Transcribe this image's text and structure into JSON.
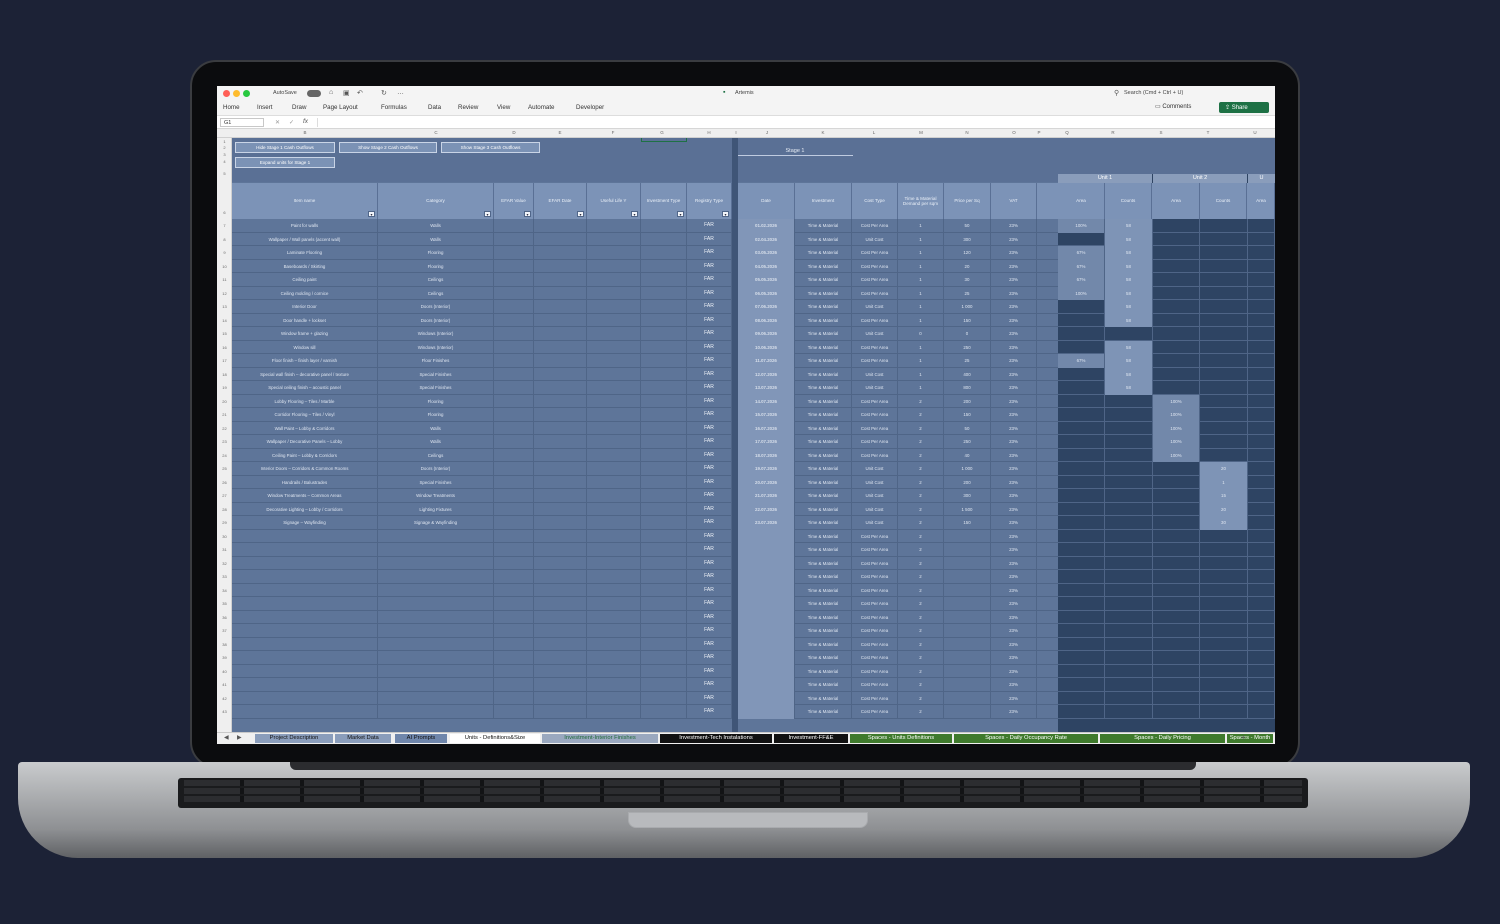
{
  "window": {
    "title": "Artemis",
    "autosave_label": "AutoSave",
    "search_placeholder": "Search (Cmd + Ctrl + U)"
  },
  "ribbon": {
    "tabs": [
      "Home",
      "Insert",
      "Draw",
      "Page Layout",
      "Formulas",
      "Data",
      "Review",
      "View",
      "Automate",
      "Developer"
    ],
    "comments_label": "Comments",
    "share_label": "Share"
  },
  "formula_bar": {
    "cell_ref": "G1",
    "fx_label": "fx"
  },
  "columns": [
    "B",
    "C",
    "D",
    "E",
    "F",
    "G",
    "H",
    "I",
    "J",
    "K",
    "L",
    "M",
    "N",
    "O",
    "P",
    "Q",
    "R",
    "S",
    "T",
    "U"
  ],
  "row_numbers": [
    "1",
    "2",
    "3",
    "4",
    "5",
    "6",
    "7",
    "8",
    "9",
    "10",
    "11",
    "12",
    "13",
    "14",
    "15",
    "16",
    "17",
    "18",
    "19",
    "20",
    "21",
    "22",
    "23",
    "24",
    "25",
    "26",
    "27",
    "28",
    "29",
    "30",
    "31",
    "32",
    "33",
    "34",
    "35",
    "36",
    "37",
    "38",
    "39",
    "40",
    "41",
    "42",
    "43"
  ],
  "buttons": {
    "hide_stage1": "Hide Stage 1 Cash Outflows",
    "show_stage2": "Show Stage 2 Cash Outflows",
    "show_stage3": "Show Stage 3 Cash Outflows",
    "expand_units": "Expand units for Stage 1"
  },
  "stage_label": "Stage 1",
  "units": [
    "Unit 1",
    "Unit 2",
    "U"
  ],
  "headers": {
    "item_name": "Item name",
    "category": "Category",
    "efar_value": "EFAR Value",
    "efar_date": "EFAR Date",
    "useful_life": "Useful Life Y",
    "investment_type": "Investment Type",
    "registry_type": "Registry Type",
    "date": "Date",
    "investment": "Investment",
    "cost_type": "Cost Type",
    "demand": "Time & Material Demand per sqm",
    "price": "Price per Sq",
    "vat": "VAT",
    "u1_area": "Area",
    "u1_counts": "Counts",
    "u2_area": "Area",
    "u2_counts": "Counts",
    "u3_area": "Area"
  },
  "rows": [
    {
      "item": "Paint for walls",
      "cat": "Walls",
      "reg": "FAR",
      "date": "01.02.2026",
      "inv": "Time & Material",
      "cost": "Cost Per Area",
      "dem": "1",
      "price": "50",
      "vat": "23%",
      "u1a": "100%",
      "u1c": "58",
      "u2a": "",
      "u2c": ""
    },
    {
      "item": "Wallpaper / Wall panels (accent wall)",
      "cat": "Walls",
      "reg": "FAR",
      "date": "02.04.2026",
      "inv": "Time & Material",
      "cost": "Unit Cost",
      "dem": "1",
      "price": "300",
      "vat": "23%",
      "u1a": "",
      "u1c": "58",
      "u2a": "",
      "u2c": ""
    },
    {
      "item": "Laminate Flooring",
      "cat": "Flooring",
      "reg": "FAR",
      "date": "03.05.2026",
      "inv": "Time & Material",
      "cost": "Cost Per Area",
      "dem": "1",
      "price": "120",
      "vat": "23%",
      "u1a": "67%",
      "u1c": "58",
      "u2a": "",
      "u2c": ""
    },
    {
      "item": "Baseboards / Skirting",
      "cat": "Flooring",
      "reg": "FAR",
      "date": "04.05.2026",
      "inv": "Time & Material",
      "cost": "Cost Per Area",
      "dem": "1",
      "price": "20",
      "vat": "23%",
      "u1a": "67%",
      "u1c": "58",
      "u2a": "",
      "u2c": ""
    },
    {
      "item": "Ceiling paint",
      "cat": "Ceilings",
      "reg": "FAR",
      "date": "05.05.2026",
      "inv": "Time & Material",
      "cost": "Cost Per Area",
      "dem": "1",
      "price": "30",
      "vat": "23%",
      "u1a": "67%",
      "u1c": "58",
      "u2a": "",
      "u2c": ""
    },
    {
      "item": "Ceiling molding / cornice",
      "cat": "Ceilings",
      "reg": "FAR",
      "date": "06.05.2026",
      "inv": "Time & Material",
      "cost": "Cost Per Area",
      "dem": "1",
      "price": "25",
      "vat": "23%",
      "u1a": "100%",
      "u1c": "58",
      "u2a": "",
      "u2c": ""
    },
    {
      "item": "Interior Door",
      "cat": "Doors (Interior)",
      "reg": "FAR",
      "date": "07.06.2026",
      "inv": "Time & Material",
      "cost": "Unit Cost",
      "dem": "1",
      "price": "1 000",
      "vat": "23%",
      "u1a": "",
      "u1c": "58",
      "u2a": "",
      "u2c": ""
    },
    {
      "item": "Door handle + lockset",
      "cat": "Doors (Interior)",
      "reg": "FAR",
      "date": "08.06.2026",
      "inv": "Time & Material",
      "cost": "Cost Per Area",
      "dem": "1",
      "price": "150",
      "vat": "23%",
      "u1a": "",
      "u1c": "58",
      "u2a": "",
      "u2c": ""
    },
    {
      "item": "Window frame + glazing",
      "cat": "Windows (Interior)",
      "reg": "FAR",
      "date": "09.06.2026",
      "inv": "Time & Material",
      "cost": "Unit Cost",
      "dem": "0",
      "price": "0",
      "vat": "23%",
      "u1a": "",
      "u1c": "",
      "u2a": "",
      "u2c": ""
    },
    {
      "item": "Window sill",
      "cat": "Windows (Interior)",
      "reg": "FAR",
      "date": "10.06.2026",
      "inv": "Time & Material",
      "cost": "Cost Per Area",
      "dem": "1",
      "price": "250",
      "vat": "23%",
      "u1a": "",
      "u1c": "58",
      "u2a": "",
      "u2c": ""
    },
    {
      "item": "Floor finish – finish layer / varnish",
      "cat": "Floor Finishes",
      "reg": "FAR",
      "date": "11.07.2026",
      "inv": "Time & Material",
      "cost": "Cost Per Area",
      "dem": "1",
      "price": "25",
      "vat": "23%",
      "u1a": "67%",
      "u1c": "58",
      "u2a": "",
      "u2c": ""
    },
    {
      "item": "Special wall finish – decorative panel / texture",
      "cat": "Special Finishes",
      "reg": "FAR",
      "date": "12.07.2026",
      "inv": "Time & Material",
      "cost": "Unit Cost",
      "dem": "1",
      "price": "400",
      "vat": "23%",
      "u1a": "",
      "u1c": "58",
      "u2a": "",
      "u2c": ""
    },
    {
      "item": "Special ceiling finish – acoustic panel",
      "cat": "Special Finishes",
      "reg": "FAR",
      "date": "13.07.2026",
      "inv": "Time & Material",
      "cost": "Unit Cost",
      "dem": "1",
      "price": "800",
      "vat": "23%",
      "u1a": "",
      "u1c": "58",
      "u2a": "",
      "u2c": ""
    },
    {
      "item": "Lobby Flooring – Tiles / Marble",
      "cat": "Flooring",
      "reg": "FAR",
      "date": "14.07.2026",
      "inv": "Time & Material",
      "cost": "Cost Per Area",
      "dem": "2",
      "price": "200",
      "vat": "23%",
      "u1a": "",
      "u1c": "",
      "u2a": "100%",
      "u2c": ""
    },
    {
      "item": "Corridor Flooring – Tiles / Vinyl",
      "cat": "Flooring",
      "reg": "FAR",
      "date": "15.07.2026",
      "inv": "Time & Material",
      "cost": "Cost Per Area",
      "dem": "2",
      "price": "150",
      "vat": "23%",
      "u1a": "",
      "u1c": "",
      "u2a": "100%",
      "u2c": ""
    },
    {
      "item": "Wall Paint – Lobby & Corridors",
      "cat": "Walls",
      "reg": "FAR",
      "date": "16.07.2026",
      "inv": "Time & Material",
      "cost": "Cost Per Area",
      "dem": "2",
      "price": "50",
      "vat": "23%",
      "u1a": "",
      "u1c": "",
      "u2a": "100%",
      "u2c": ""
    },
    {
      "item": "Wallpaper / Decorative Panels – Lobby",
      "cat": "Walls",
      "reg": "FAR",
      "date": "17.07.2026",
      "inv": "Time & Material",
      "cost": "Cost Per Area",
      "dem": "2",
      "price": "250",
      "vat": "23%",
      "u1a": "",
      "u1c": "",
      "u2a": "100%",
      "u2c": ""
    },
    {
      "item": "Ceiling Paint – Lobby & Corridors",
      "cat": "Ceilings",
      "reg": "FAR",
      "date": "18.07.2026",
      "inv": "Time & Material",
      "cost": "Cost Per Area",
      "dem": "2",
      "price": "40",
      "vat": "23%",
      "u1a": "",
      "u1c": "",
      "u2a": "100%",
      "u2c": ""
    },
    {
      "item": "Interior Doors – Corridors & Common Rooms",
      "cat": "Doors (Interior)",
      "reg": "FAR",
      "date": "19.07.2026",
      "inv": "Time & Material",
      "cost": "Unit Cost",
      "dem": "2",
      "price": "1 000",
      "vat": "23%",
      "u1a": "",
      "u1c": "",
      "u2a": "",
      "u2c": "20"
    },
    {
      "item": "Handrails / Balustrades",
      "cat": "Special Finishes",
      "reg": "FAR",
      "date": "20.07.2026",
      "inv": "Time & Material",
      "cost": "Unit Cost",
      "dem": "2",
      "price": "200",
      "vat": "23%",
      "u1a": "",
      "u1c": "",
      "u2a": "",
      "u2c": "1"
    },
    {
      "item": "Window Treatments – Common Areas",
      "cat": "Window Treatments",
      "reg": "FAR",
      "date": "21.07.2026",
      "inv": "Time & Material",
      "cost": "Unit Cost",
      "dem": "2",
      "price": "300",
      "vat": "23%",
      "u1a": "",
      "u1c": "",
      "u2a": "",
      "u2c": "15"
    },
    {
      "item": "Decorative Lighting – Lobby / Corridors",
      "cat": "Lighting Fixtures",
      "reg": "FAR",
      "date": "22.07.2026",
      "inv": "Time & Material",
      "cost": "Unit Cost",
      "dem": "2",
      "price": "1 500",
      "vat": "23%",
      "u1a": "",
      "u1c": "",
      "u2a": "",
      "u2c": "20"
    },
    {
      "item": "Signage – Wayfinding",
      "cat": "Signage & Wayfinding",
      "reg": "FAR",
      "date": "23.07.2026",
      "inv": "Time & Material",
      "cost": "Unit Cost",
      "dem": "2",
      "price": "150",
      "vat": "23%",
      "u1a": "",
      "u1c": "",
      "u2a": "",
      "u2c": "30"
    },
    {
      "item": "",
      "cat": "",
      "reg": "FAR",
      "date": "",
      "inv": "Time & Material",
      "cost": "Cost Per Area",
      "dem": "2",
      "price": "",
      "vat": "23%",
      "u1a": "",
      "u1c": "",
      "u2a": "",
      "u2c": ""
    },
    {
      "item": "",
      "cat": "",
      "reg": "FAR",
      "date": "",
      "inv": "Time & Material",
      "cost": "Cost Per Area",
      "dem": "2",
      "price": "",
      "vat": "23%",
      "u1a": "",
      "u1c": "",
      "u2a": "",
      "u2c": ""
    },
    {
      "item": "",
      "cat": "",
      "reg": "FAR",
      "date": "",
      "inv": "Time & Material",
      "cost": "Cost Per Area",
      "dem": "2",
      "price": "",
      "vat": "23%",
      "u1a": "",
      "u1c": "",
      "u2a": "",
      "u2c": ""
    },
    {
      "item": "",
      "cat": "",
      "reg": "FAR",
      "date": "",
      "inv": "Time & Material",
      "cost": "Cost Per Area",
      "dem": "2",
      "price": "",
      "vat": "23%",
      "u1a": "",
      "u1c": "",
      "u2a": "",
      "u2c": ""
    },
    {
      "item": "",
      "cat": "",
      "reg": "FAR",
      "date": "",
      "inv": "Time & Material",
      "cost": "Cost Per Area",
      "dem": "2",
      "price": "",
      "vat": "23%",
      "u1a": "",
      "u1c": "",
      "u2a": "",
      "u2c": ""
    },
    {
      "item": "",
      "cat": "",
      "reg": "FAR",
      "date": "",
      "inv": "Time & Material",
      "cost": "Cost Per Area",
      "dem": "2",
      "price": "",
      "vat": "23%",
      "u1a": "",
      "u1c": "",
      "u2a": "",
      "u2c": ""
    },
    {
      "item": "",
      "cat": "",
      "reg": "FAR",
      "date": "",
      "inv": "Time & Material",
      "cost": "Cost Per Area",
      "dem": "2",
      "price": "",
      "vat": "23%",
      "u1a": "",
      "u1c": "",
      "u2a": "",
      "u2c": ""
    },
    {
      "item": "",
      "cat": "",
      "reg": "FAR",
      "date": "",
      "inv": "Time & Material",
      "cost": "Cost Per Area",
      "dem": "2",
      "price": "",
      "vat": "23%",
      "u1a": "",
      "u1c": "",
      "u2a": "",
      "u2c": ""
    },
    {
      "item": "",
      "cat": "",
      "reg": "FAR",
      "date": "",
      "inv": "Time & Material",
      "cost": "Cost Per Area",
      "dem": "2",
      "price": "",
      "vat": "23%",
      "u1a": "",
      "u1c": "",
      "u2a": "",
      "u2c": ""
    },
    {
      "item": "",
      "cat": "",
      "reg": "FAR",
      "date": "",
      "inv": "Time & Material",
      "cost": "Cost Per Area",
      "dem": "2",
      "price": "",
      "vat": "23%",
      "u1a": "",
      "u1c": "",
      "u2a": "",
      "u2c": ""
    },
    {
      "item": "",
      "cat": "",
      "reg": "FAR",
      "date": "",
      "inv": "Time & Material",
      "cost": "Cost Per Area",
      "dem": "2",
      "price": "",
      "vat": "23%",
      "u1a": "",
      "u1c": "",
      "u2a": "",
      "u2c": ""
    },
    {
      "item": "",
      "cat": "",
      "reg": "FAR",
      "date": "",
      "inv": "Time & Material",
      "cost": "Cost Per Area",
      "dem": "2",
      "price": "",
      "vat": "23%",
      "u1a": "",
      "u1c": "",
      "u2a": "",
      "u2c": ""
    },
    {
      "item": "",
      "cat": "",
      "reg": "FAR",
      "date": "",
      "inv": "Time & Material",
      "cost": "Cost Per Area",
      "dem": "2",
      "price": "",
      "vat": "23%",
      "u1a": "",
      "u1c": "",
      "u2a": "",
      "u2c": ""
    },
    {
      "item": "",
      "cat": "",
      "reg": "FAR",
      "date": "",
      "inv": "Time & Material",
      "cost": "Cost Per Area",
      "dem": "2",
      "price": "",
      "vat": "23%",
      "u1a": "",
      "u1c": "",
      "u2a": "",
      "u2c": ""
    }
  ],
  "sheet_tabs": [
    {
      "label": "Project Description",
      "bg": "#8a9dbb",
      "fg": "#111"
    },
    {
      "label": "Market Data",
      "bg": "#8a9dbb",
      "fg": "#111"
    },
    {
      "label": "AI Prompts",
      "bg": "#6f86ab",
      "fg": "#111"
    },
    {
      "label": "Units - Definitions&Size",
      "bg": "#ffffff",
      "fg": "#111"
    },
    {
      "label": "Investment-Interior Finishes",
      "bg": "#9aa8bf",
      "fg": "#1f6b3a"
    },
    {
      "label": "Investment-Tech Instalations",
      "bg": "#111111",
      "fg": "#ffffff"
    },
    {
      "label": "Investment-FF&E",
      "bg": "#111111",
      "fg": "#ffffff"
    },
    {
      "label": "Spaces - Units Definitions",
      "bg": "#3f7a2c",
      "fg": "#ffffff"
    },
    {
      "label": "Spaces - Daily Occupancy Rate",
      "bg": "#3f7a2c",
      "fg": "#ffffff"
    },
    {
      "label": "Spaces - Daily Pricing",
      "bg": "#3f7a2c",
      "fg": "#ffffff"
    },
    {
      "label": "Spaces - Month",
      "bg": "#3f7a2c",
      "fg": "#ffffff"
    }
  ],
  "add_sheet_label": "+"
}
